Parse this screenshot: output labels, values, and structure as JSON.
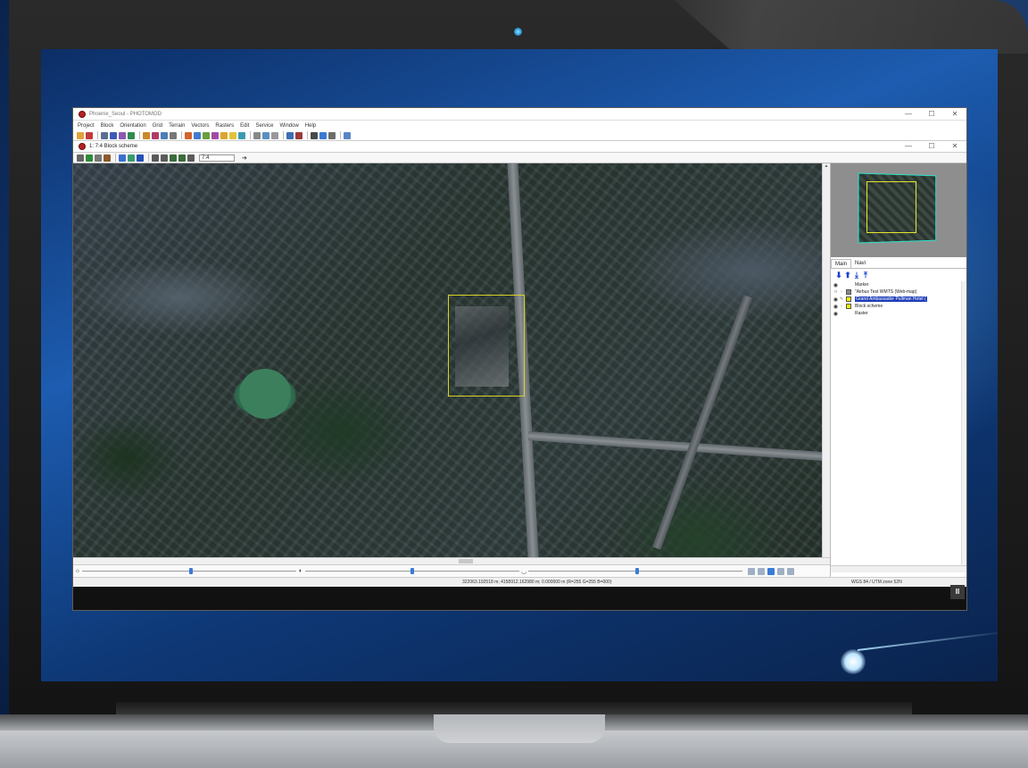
{
  "app": {
    "title": "Phoenix_Seoul - PHOTOMOD",
    "window_controls": [
      "—",
      "☐",
      "✕"
    ]
  },
  "menu": [
    "Project",
    "Block",
    "Orientation",
    "Grid",
    "Terrain",
    "Vectors",
    "Rasters",
    "Edit",
    "Service",
    "Window",
    "Help"
  ],
  "document": {
    "title": "1: 7:4 Block scheme",
    "controls": [
      "—",
      "☐",
      "✕"
    ],
    "zoom_value": "7:4"
  },
  "panel": {
    "tabs": [
      "Main",
      "Navi"
    ],
    "tree": [
      {
        "label": "Marker",
        "check": "none",
        "selected": false
      },
      {
        "label": "\"Airbus Test WMTS (Web-map)",
        "check": "gray",
        "selected": false
      },
      {
        "label": "Grand Ambassador Pullman Hotel (",
        "check": "yellow",
        "selected": true
      },
      {
        "label": "Block scheme",
        "check": "yellow",
        "selected": false
      },
      {
        "label": "Raster",
        "check": "none",
        "selected": false
      }
    ]
  },
  "status": {
    "coordinates": "322063.192518 m; 4158912.162980 m; 0.000000 m  (R=255 G=255 B=000)",
    "crs": "WGS 84 / UTM zone 52N"
  },
  "pause_label": "II",
  "colors": {
    "selection": "#d8d322",
    "overview_frame": "#2be0c6",
    "layer_selected": "#1d3db8",
    "app_icon": "#b52222"
  },
  "icons": {
    "toolbar": [
      "open-icon",
      "save-icon",
      "grid-icon",
      "layers-icon",
      "triangulation-icon",
      "vector-icon",
      "raster-icon",
      "settings-icon"
    ],
    "doc_toolbar": [
      "pointer-icon",
      "add-icon",
      "list-icon",
      "pan-icon",
      "raster-icon",
      "zoom-in-icon",
      "zoom-out-icon",
      "zoom-fit-icon",
      "zoom-window-icon"
    ]
  }
}
